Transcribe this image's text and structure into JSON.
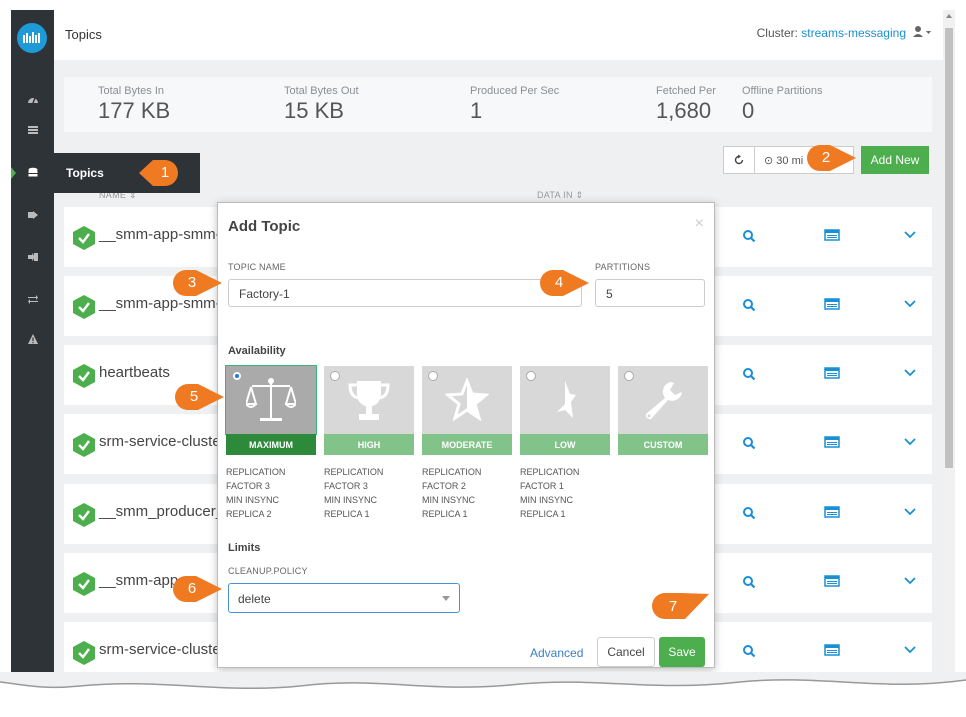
{
  "header": {
    "title": "Topics",
    "cluster_label": "Cluster:",
    "cluster_name": "streams-messaging"
  },
  "stats": [
    {
      "label": "Total Bytes In",
      "value": "177 KB"
    },
    {
      "label": "Total Bytes Out",
      "value": "15 KB"
    },
    {
      "label": "Produced Per Sec",
      "value": "1"
    },
    {
      "label": "Fetched Per",
      "value": "1,680"
    },
    {
      "label": "Offline Partitions",
      "value": "0"
    }
  ],
  "toolbar": {
    "time_label": "30 mi",
    "add_new_label": "Add New"
  },
  "sidebar": {
    "tooltip": "Topics"
  },
  "columns": {
    "name": "NAME ⇕",
    "data_in": "DATA IN ⇕"
  },
  "rows": [
    {
      "name": "__smm-app-smm-"
    },
    {
      "name": "__smm-app-smm-"
    },
    {
      "name": "heartbeats"
    },
    {
      "name": "srm-service-cluste"
    },
    {
      "name": "__smm_producer_"
    },
    {
      "name": "__smm-app"
    },
    {
      "name": "srm-service-cluste"
    }
  ],
  "modal": {
    "title": "Add Topic",
    "close": "×",
    "topic_name_label": "TOPIC NAME",
    "topic_name_value": "Factory-1",
    "partitions_label": "PARTITIONS",
    "partitions_value": "5",
    "availability_label": "Availability",
    "options": [
      {
        "label": "MAXIMUM",
        "desc1": "REPLICATION",
        "desc2": "FACTOR 3",
        "desc3": "MIN INSYNC",
        "desc4": "REPLICA 2",
        "icon": "scales-icon"
      },
      {
        "label": "HIGH",
        "desc1": "REPLICATION",
        "desc2": "FACTOR 3",
        "desc3": "MIN INSYNC",
        "desc4": "REPLICA 1",
        "icon": "trophy-icon"
      },
      {
        "label": "MODERATE",
        "desc1": "REPLICATION",
        "desc2": "FACTOR 2",
        "desc3": "MIN INSYNC",
        "desc4": "REPLICA 1",
        "icon": "star-half-icon"
      },
      {
        "label": "LOW",
        "desc1": "REPLICATION",
        "desc2": "FACTOR 1",
        "desc3": "MIN INSYNC",
        "desc4": "REPLICA 1",
        "icon": "star-sliver-icon"
      },
      {
        "label": "CUSTOM",
        "icon": "wrench-icon"
      }
    ],
    "limits_label": "Limits",
    "cleanup_label": "CLEANUP.POLICY",
    "cleanup_value": "delete",
    "advanced_label": "Advanced",
    "cancel_label": "Cancel",
    "save_label": "Save"
  },
  "callouts": [
    "1",
    "2",
    "3",
    "4",
    "5",
    "6",
    "7"
  ],
  "colors": {
    "accent_green": "#4cae4c",
    "callout_orange": "#f07a22",
    "link_blue": "#1a8fd6",
    "sidebar_dark": "#2e3338"
  }
}
